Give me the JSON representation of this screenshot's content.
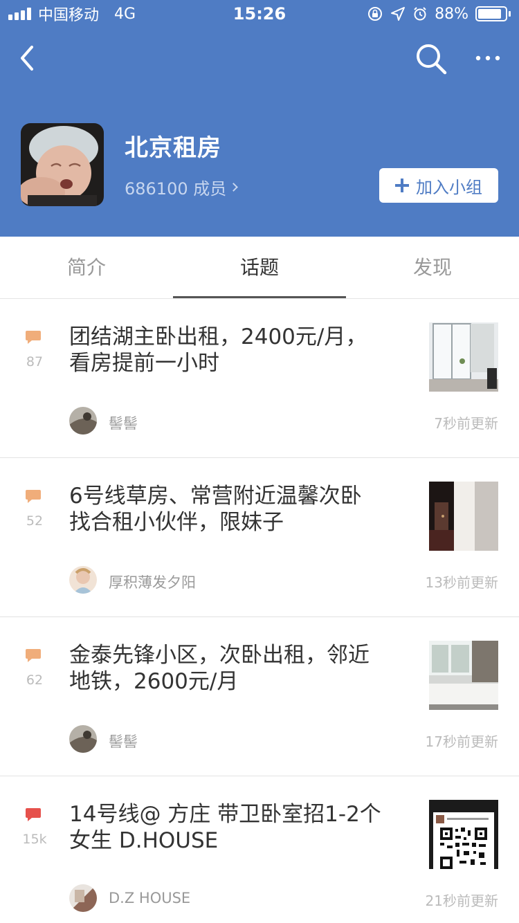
{
  "status_bar": {
    "carrier": "中国移动",
    "network": "4G",
    "time": "15:26",
    "battery": "88%",
    "battery_level": 0.88
  },
  "nav": {
    "back_icon": "chevron-left-icon",
    "search_icon": "search-icon",
    "more_icon": "more-icon"
  },
  "group": {
    "name": "北京租房",
    "members": "686100 成员",
    "join_label": "加入小组"
  },
  "tabs": [
    {
      "label": "简介",
      "active": false
    },
    {
      "label": "话题",
      "active": true
    },
    {
      "label": "发现",
      "active": false
    }
  ],
  "topics": [
    {
      "title_line1": "团结湖主卧出租，2400元/月，",
      "title_line2": "看房提前一小时",
      "comments": "87",
      "author": "髻髻",
      "updated": "7秒前更新",
      "hot": false
    },
    {
      "title_line1": "6号线草房、常营附近温馨次卧",
      "title_line2": "找合租小伙伴，限妹子",
      "comments": "52",
      "author": "厚积薄发夕阳",
      "updated": "13秒前更新",
      "hot": false
    },
    {
      "title_line1": "金泰先锋小区，次卧出租，邻近",
      "title_line2": "地铁，2600元/月",
      "comments": "62",
      "author": "髻髻",
      "updated": "17秒前更新",
      "hot": false
    },
    {
      "title_line1": "14号线@ 方庄 带卫卧室招1-2个",
      "title_line2": "女生 D.HOUSE",
      "comments": "15k",
      "author": "D.Z HOUSE",
      "updated": "21秒前更新",
      "hot": true
    }
  ],
  "colors": {
    "header_bg": "#4f7cc4",
    "comment_icon": "#f0ad7a",
    "comment_icon_hot": "#e6514c"
  }
}
